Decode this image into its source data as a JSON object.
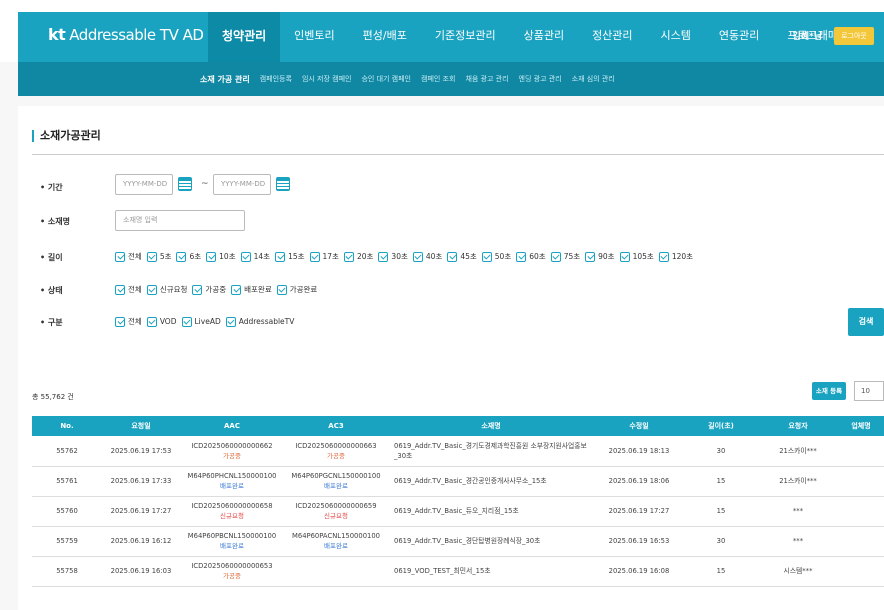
{
  "header": {
    "logo_kt": "kt",
    "logo_text": "Addressable TV AD",
    "menu": [
      "청약관리",
      "인벤토리",
      "편성/배포",
      "기준정보관리",
      "상품관리",
      "정산관리",
      "시스템",
      "연동관리",
      "프로그래매틱"
    ],
    "user": "김혜*님",
    "logout": "로그아웃"
  },
  "submenu": [
    "소재 가공 관리",
    "캠페인등록",
    "임시 저장 캠페인",
    "승인 대기 캠페인",
    "캠페인 조회",
    "채움 광고 관리",
    "엔딩 광고 관리",
    "소재 심의 관리"
  ],
  "page_title": "소재가공관리",
  "filters": {
    "period_label": "• 기간",
    "date_from_placeholder": "YYYY-MM-DD",
    "tilde": "~",
    "date_to_placeholder": "YYYY-MM-DD",
    "name_label": "• 소재명",
    "name_placeholder": "소재명 입력",
    "length_label": "• 길이",
    "length_options": [
      "전체",
      "5초",
      "6초",
      "10초",
      "14초",
      "15초",
      "17초",
      "20초",
      "30초",
      "40초",
      "45초",
      "50초",
      "60초",
      "75초",
      "90초",
      "105초",
      "120초"
    ],
    "status_label": "• 상태",
    "status_options": [
      "전체",
      "신규요청",
      "가공중",
      "배포완료",
      "가공완료"
    ],
    "type_label": "• 구분",
    "type_options": [
      "전체",
      "VOD",
      "LiveAD",
      "AddressableTV"
    ],
    "search_button": "검색"
  },
  "list": {
    "total": "총 55,762 건",
    "register_button": "소재 등록",
    "page_size": "10",
    "columns": [
      "No.",
      "요청일",
      "AAC",
      "AC3",
      "소재명",
      "수정일",
      "길이(초)",
      "요청자",
      "업체명"
    ],
    "rows": [
      {
        "no": "55762",
        "req": "2025.06.19 17:53",
        "aac": "ICD2025060000000662",
        "aac_status": "가공중",
        "ac3": "ICD2025060000000663",
        "ac3_status": "가공중",
        "name": "0619_Addr.TV_Basic_경기도경제과학진흥원 소부장지원사업홍보_30초",
        "mod": "2025.06.19 18:13",
        "len": "30",
        "requester": "21스카이***",
        "company": ""
      },
      {
        "no": "55761",
        "req": "2025.06.19 17:33",
        "aac": "M64P60PHCNL150000100",
        "aac_status": "배포완료",
        "ac3": "M64P60PGCNL150000100",
        "ac3_status": "배포완료",
        "name": "0619_Addr.TV_Basic_경간공인중개사사무소_15초",
        "mod": "2025.06.19 18:06",
        "len": "15",
        "requester": "21스카이***",
        "company": ""
      },
      {
        "no": "55760",
        "req": "2025.06.19 17:27",
        "aac": "ICD2025060000000658",
        "aac_status": "신규요청",
        "ac3": "ICD2025060000000659",
        "ac3_status": "신규요청",
        "name": "0619_Addr.TV_Basic_듀오_지리점_15초",
        "mod": "2025.06.19 17:27",
        "len": "15",
        "requester": "***",
        "company": ""
      },
      {
        "no": "55759",
        "req": "2025.06.19 16:12",
        "aac": "M64P60PBCNL150000100",
        "aac_status": "배포완료",
        "ac3": "M64P60PACNL150000100",
        "ac3_status": "배포완료",
        "name": "0619_Addr.TV_Basic_경단탑병원장례식장_30초",
        "mod": "2025.06.19 16:53",
        "len": "30",
        "requester": "***",
        "company": ""
      },
      {
        "no": "55758",
        "req": "2025.06.19 16:03",
        "aac": "ICD2025060000000653",
        "aac_status": "가공중",
        "ac3": "",
        "ac3_status": "",
        "name": "0619_VOD_TEST_최민서_15초",
        "mod": "2025.06.19 16:08",
        "len": "15",
        "requester": "시스템***",
        "company": ""
      }
    ]
  },
  "status_colors": {
    "가공중": "#e26b3c",
    "배포완료": "#3a7bd5",
    "신규요청": "#e24040"
  }
}
